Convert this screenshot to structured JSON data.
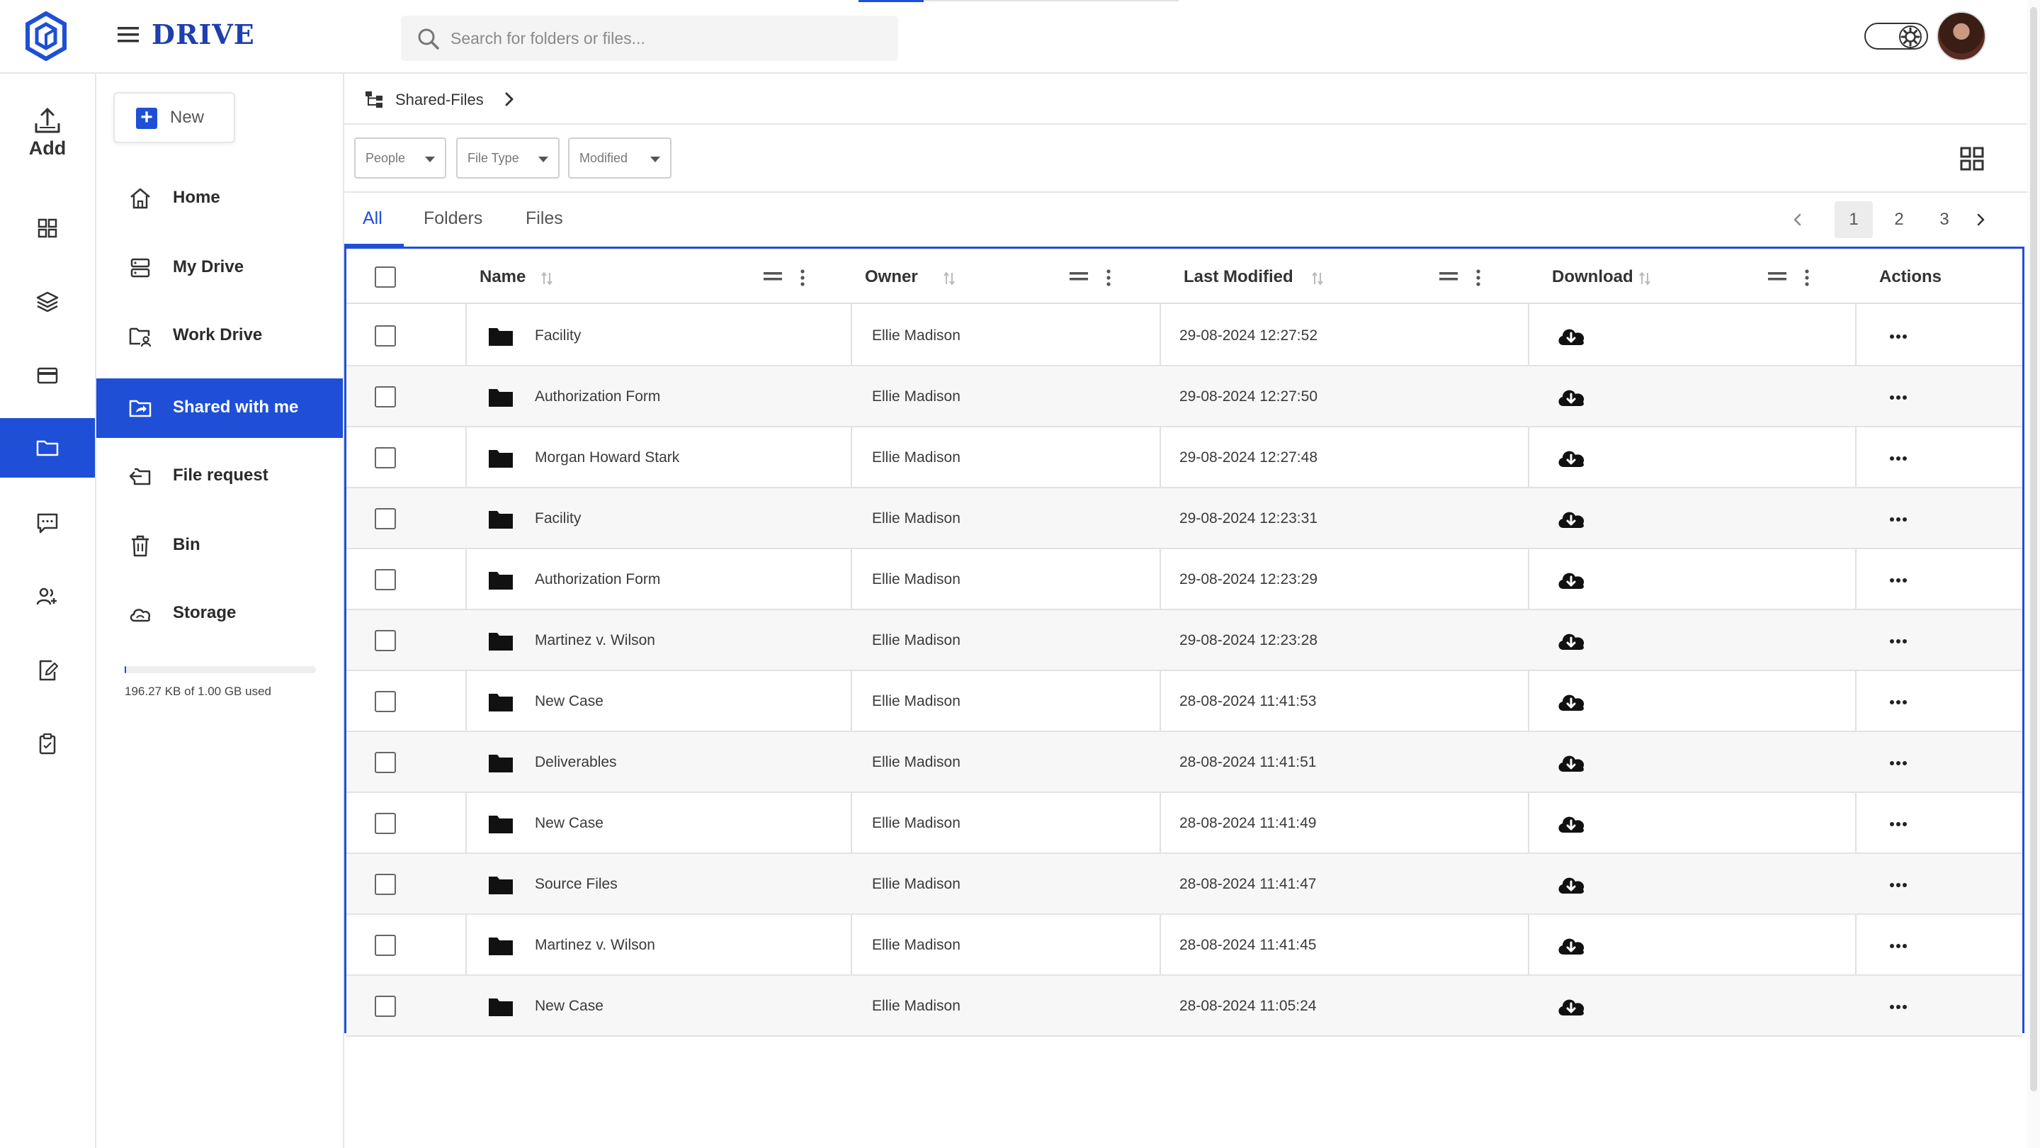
{
  "app": {
    "brand": "DRIVE"
  },
  "search": {
    "placeholder": "Search for folders or files..."
  },
  "rail": {
    "add_label": "Add"
  },
  "nav": {
    "new_label": "New",
    "items": [
      {
        "label": "Home",
        "icon": "home-icon"
      },
      {
        "label": "My Drive",
        "icon": "drive-icon"
      },
      {
        "label": "Work Drive",
        "icon": "work-folder-icon"
      },
      {
        "label": "Shared with me",
        "icon": "shared-folder-icon",
        "active": true
      },
      {
        "label": "File request",
        "icon": "file-request-icon"
      },
      {
        "label": "Bin",
        "icon": "trash-icon"
      },
      {
        "label": "Storage",
        "icon": "cloud-icon"
      }
    ],
    "storage_text": "196.27 KB of 1.00 GB used",
    "storage_fraction": 0.0002
  },
  "breadcrumb": {
    "label": "Shared-Files"
  },
  "filters": {
    "people": "People",
    "file_type": "File Type",
    "modified": "Modified"
  },
  "tabs": [
    "All",
    "Folders",
    "Files"
  ],
  "pagination": {
    "pages": [
      "1",
      "2",
      "3"
    ],
    "current": "1"
  },
  "table": {
    "headers": {
      "name": "Name",
      "owner": "Owner",
      "last_modified": "Last Modified",
      "download": "Download",
      "actions": "Actions"
    },
    "rows": [
      {
        "name": "Facility",
        "owner": "Ellie Madison",
        "modified": "29-08-2024 12:27:52"
      },
      {
        "name": "Authorization Form",
        "owner": "Ellie Madison",
        "modified": "29-08-2024 12:27:50"
      },
      {
        "name": "Morgan Howard Stark",
        "owner": "Ellie Madison",
        "modified": "29-08-2024 12:27:48"
      },
      {
        "name": "Facility",
        "owner": "Ellie Madison",
        "modified": "29-08-2024 12:23:31"
      },
      {
        "name": "Authorization Form",
        "owner": "Ellie Madison",
        "modified": "29-08-2024 12:23:29"
      },
      {
        "name": "Martinez v. Wilson",
        "owner": "Ellie Madison",
        "modified": "29-08-2024 12:23:28"
      },
      {
        "name": "New Case",
        "owner": "Ellie Madison",
        "modified": "28-08-2024 11:41:53"
      },
      {
        "name": "Deliverables",
        "owner": "Ellie Madison",
        "modified": "28-08-2024 11:41:51"
      },
      {
        "name": "New Case",
        "owner": "Ellie Madison",
        "modified": "28-08-2024 11:41:49"
      },
      {
        "name": "Source Files",
        "owner": "Ellie Madison",
        "modified": "28-08-2024 11:41:47"
      },
      {
        "name": "Martinez v. Wilson",
        "owner": "Ellie Madison",
        "modified": "28-08-2024 11:41:45"
      },
      {
        "name": "New Case",
        "owner": "Ellie Madison",
        "modified": "28-08-2024 11:05:24"
      }
    ]
  },
  "colors": {
    "accent": "#1e4fd6",
    "brand": "#1e3fae"
  }
}
